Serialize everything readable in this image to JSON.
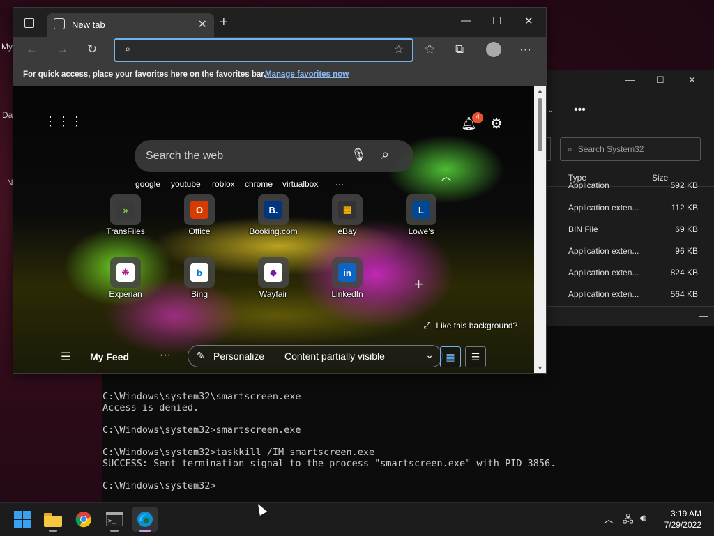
{
  "desktop": {
    "labels": [
      "My",
      "Da",
      "N"
    ]
  },
  "browser": {
    "tab_title": "New tab",
    "tab_close": "✕",
    "new_tab": "+",
    "window": {
      "minimize": "—",
      "maximize": "☐",
      "close": "✕"
    },
    "address_value": "",
    "favbar_message": "For quick access, place your favorites here on the favorites bar.",
    "favbar_link": "Manage favorites now",
    "ntp": {
      "notification_count": "4",
      "search_placeholder": "Search the web",
      "quick_links": [
        "google",
        "youtube",
        "roblox",
        "chrome",
        "virtualbox"
      ],
      "quick_more": "···",
      "tiles": [
        {
          "name": "TransFiles",
          "glyph": "»",
          "bg": "#3a3a3a",
          "fg": "#7fd13b"
        },
        {
          "name": "Office",
          "glyph": "O",
          "bg": "#d83b01",
          "fg": "#ffffff"
        },
        {
          "name": "Booking.com",
          "glyph": "B.",
          "bg": "#003580",
          "fg": "#ffffff"
        },
        {
          "name": "eBay",
          "glyph": "▦",
          "bg": "#333333",
          "fg": "#f5af02"
        },
        {
          "name": "Lowe's",
          "glyph": "L",
          "bg": "#004990",
          "fg": "#ffffff"
        },
        {
          "name": "Experian",
          "glyph": "❈",
          "bg": "#ffffff",
          "fg": "#af1685"
        },
        {
          "name": "Bing",
          "glyph": "b",
          "bg": "#ffffff",
          "fg": "#0078d4"
        },
        {
          "name": "Wayfair",
          "glyph": "◆",
          "bg": "#ffffff",
          "fg": "#7b189f"
        },
        {
          "name": "LinkedIn",
          "glyph": "in",
          "bg": "#0a66c2",
          "fg": "#ffffff"
        }
      ],
      "like_background": "Like this background?",
      "feed": {
        "title": "My Feed",
        "more": "···",
        "personalize": "Personalize",
        "content_visibility": "Content partially visible"
      }
    }
  },
  "explorer": {
    "search_placeholder": "Search System32",
    "columns": [
      "Type",
      "Size"
    ],
    "rows": [
      {
        "type": "Application",
        "size": "592 KB"
      },
      {
        "type": "Application exten...",
        "size": "112 KB"
      },
      {
        "type": "BIN File",
        "size": "69 KB"
      },
      {
        "type": "Application exten...",
        "size": "96 KB"
      },
      {
        "type": "Application exten...",
        "size": "824 KB"
      },
      {
        "type": "Application exten...",
        "size": "564 KB"
      }
    ]
  },
  "terminal": {
    "lines": [
      "C:\\Windows\\system32\\smartscreen.exe",
      "Access is denied.",
      "",
      "C:\\Windows\\system32>smartscreen.exe",
      "",
      "C:\\Windows\\system32>taskkill /IM smartscreen.exe",
      "SUCCESS: Sent termination signal to the process \"smartscreen.exe\" with PID 3856.",
      "",
      "C:\\Windows\\system32>"
    ]
  },
  "taskbar": {
    "time": "3:19 AM",
    "date": "7/29/2022"
  }
}
